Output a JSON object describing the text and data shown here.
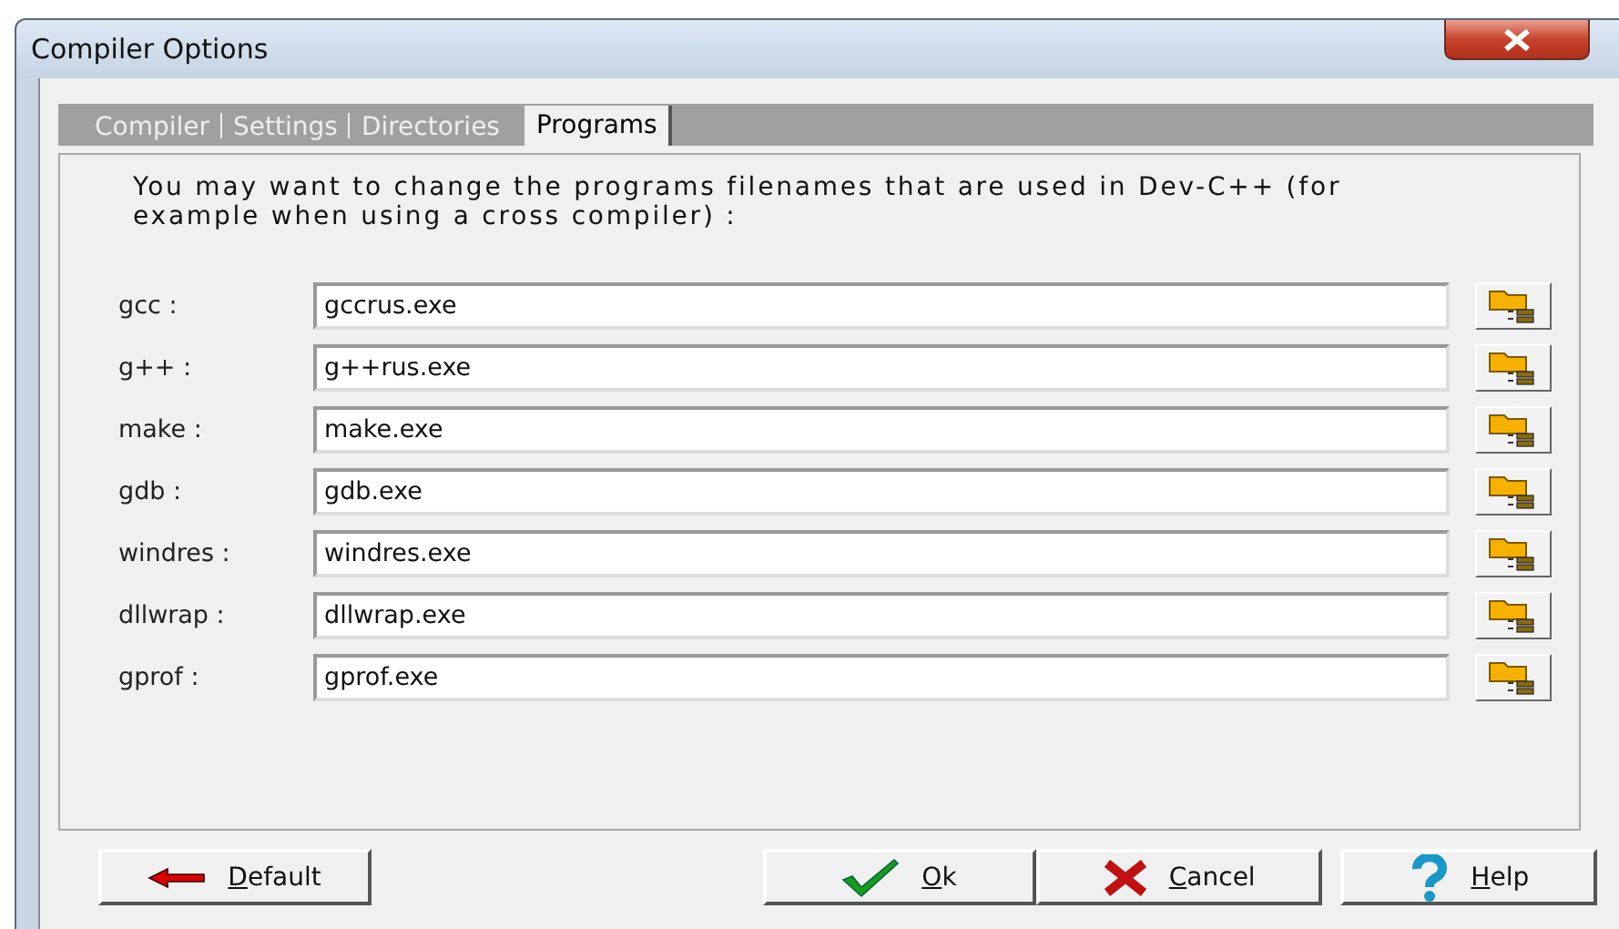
{
  "window": {
    "title": "Compiler Options"
  },
  "tabs": [
    {
      "label": "Compiler",
      "selected": false
    },
    {
      "label": "Settings",
      "selected": false
    },
    {
      "label": "Directories",
      "selected": false
    },
    {
      "label": "Programs",
      "selected": true
    }
  ],
  "intro": "You may want to change the programs filenames that are used in Dev-C++ (for example when using a cross compiler) :",
  "programs": [
    {
      "label": "gcc :",
      "value": "gccrus.exe"
    },
    {
      "label": "g++ :",
      "value": "g++rus.exe"
    },
    {
      "label": "make :",
      "value": "make.exe"
    },
    {
      "label": "gdb :",
      "value": "gdb.exe"
    },
    {
      "label": "windres :",
      "value": "windres.exe"
    },
    {
      "label": "dllwrap :",
      "value": "dllwrap.exe"
    },
    {
      "label": "gprof :",
      "value": "gprof.exe"
    }
  ],
  "buttons": [
    {
      "kind": "default",
      "mnemonic": "D",
      "rest": "efault"
    },
    {
      "kind": "ok",
      "mnemonic": "O",
      "rest": "k"
    },
    {
      "kind": "cancel",
      "mnemonic": "C",
      "rest": "ancel"
    },
    {
      "kind": "help",
      "mnemonic": "H",
      "rest": "elp"
    }
  ]
}
